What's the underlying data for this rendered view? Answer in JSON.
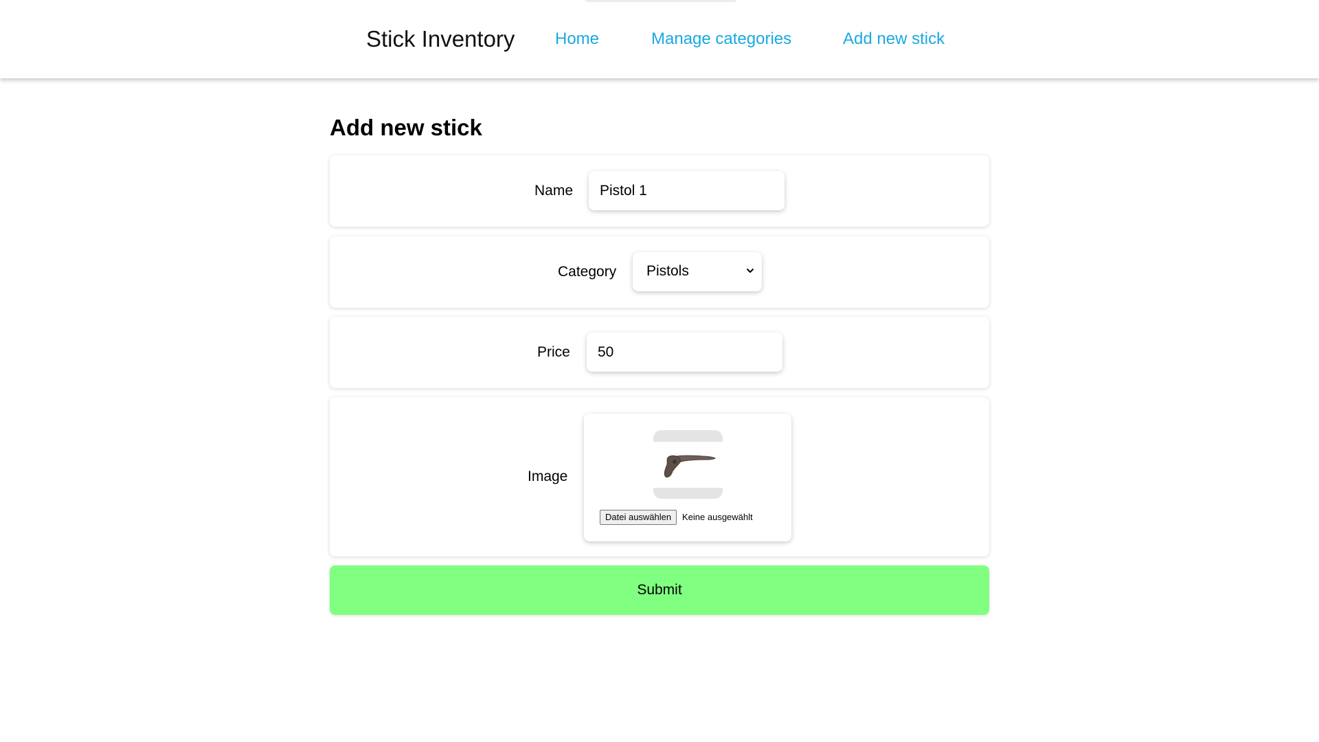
{
  "header": {
    "brand": "Stick Inventory",
    "nav": {
      "home": "Home",
      "manage_categories": "Manage categories",
      "add_new_stick": "Add new stick"
    },
    "link_color": "#1aa9e0"
  },
  "main": {
    "title": "Add new stick",
    "form": {
      "name": {
        "label": "Name",
        "value": "Pistol 1"
      },
      "category": {
        "label": "Category",
        "selected": "Pistols",
        "icon": "chevron-down-icon"
      },
      "price": {
        "label": "Price",
        "value": "50"
      },
      "image": {
        "label": "Image",
        "choose_button": "Datei auswählen",
        "status": "Keine ausgewählt",
        "thumbnail": "pistol-shaped-stick"
      },
      "submit": {
        "label": "Submit",
        "color": "#80ff80"
      }
    }
  }
}
